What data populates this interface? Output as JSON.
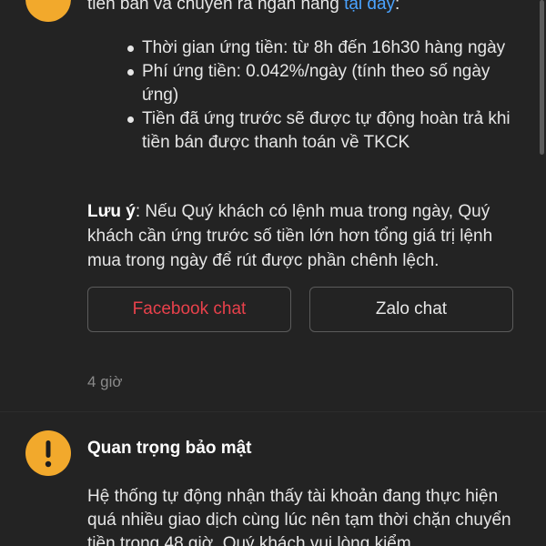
{
  "message1": {
    "top_line_prefix": "tiền bán và chuyển ra ngân hàng ",
    "top_line_link": "tại đây",
    "top_line_suffix": ":",
    "bullets": [
      "Thời gian ứng tiền: từ 8h đến 16h30 hàng ngày",
      "Phí ứng tiền: 0.042%/ngày (tính theo số ngày ứng)",
      "Tiền đã ứng trước sẽ được tự động hoàn trả khi tiền bán được thanh toán về TKCK"
    ],
    "note_label": "Lưu ý",
    "note_text": ": Nếu Quý khách có lệnh mua trong ngày, Quý khách cần ứng trước số tiền lớn hơn tổng giá trị lệnh mua trong ngày để rút được phần chênh lệch.",
    "facebook_label": "Facebook chat",
    "zalo_label": "Zalo chat",
    "time": "4 giờ"
  },
  "message2": {
    "icon": "warning-icon",
    "title": "Quan trọng bảo mật",
    "body": "Hệ thống tự động nhận thấy tài khoản đang thực hiện quá nhiều giao dịch cùng lúc nên tạm thời chặn chuyển tiền trong 48 giờ. Quý khách vui lòng kiểm"
  },
  "colors": {
    "background": "#232323",
    "accent_warning": "#f2a92c",
    "link": "#4aa3ff",
    "facebook_red": "#e8414b"
  }
}
